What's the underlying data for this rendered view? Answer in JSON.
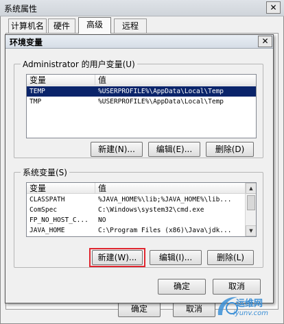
{
  "outer_window": {
    "title": "系统属性",
    "close_glyph": "✕",
    "tabs": [
      "计算机名",
      "硬件",
      "高级",
      "远程"
    ],
    "active_tab": "高级",
    "ok_label": "确定",
    "cancel_label": "取消"
  },
  "dialog": {
    "title": "环境变量",
    "close_glyph": "✕",
    "user_group_label": "Administrator 的用户变量(U)",
    "user_vars": {
      "columns": [
        "变量",
        "值"
      ],
      "rows": [
        {
          "name": "TEMP",
          "value": "%USERPROFILE%\\AppData\\Local\\Temp",
          "selected": true
        },
        {
          "name": "TMP",
          "value": "%USERPROFILE%\\AppData\\Local\\Temp",
          "selected": false
        }
      ]
    },
    "user_buttons": {
      "new": "新建(N)...",
      "edit": "编辑(E)...",
      "delete": "删除(D)"
    },
    "system_group_label": "系统变量(S)",
    "system_vars": {
      "columns": [
        "变量",
        "值"
      ],
      "rows": [
        {
          "name": "CLASSPATH",
          "value": "%JAVA_HOME%\\lib;%JAVA_HOME%\\lib..."
        },
        {
          "name": "ComSpec",
          "value": "C:\\Windows\\system32\\cmd.exe"
        },
        {
          "name": "FP_NO_HOST_C...",
          "value": "NO"
        },
        {
          "name": "JAVA_HOME",
          "value": "C:\\Program Files (x86)\\Java\\jdk..."
        }
      ]
    },
    "system_buttons": {
      "new": "新建(W)...",
      "edit": "编辑(I)...",
      "delete": "删除(L)"
    },
    "ok_label": "确定",
    "cancel_label": "取消"
  },
  "watermark": {
    "line1": "运维网",
    "line2": "iyunv.com"
  },
  "colors": {
    "selection": "#0a246a",
    "highlight_box": "#e0262f",
    "watermark": "#3b8fd6"
  }
}
